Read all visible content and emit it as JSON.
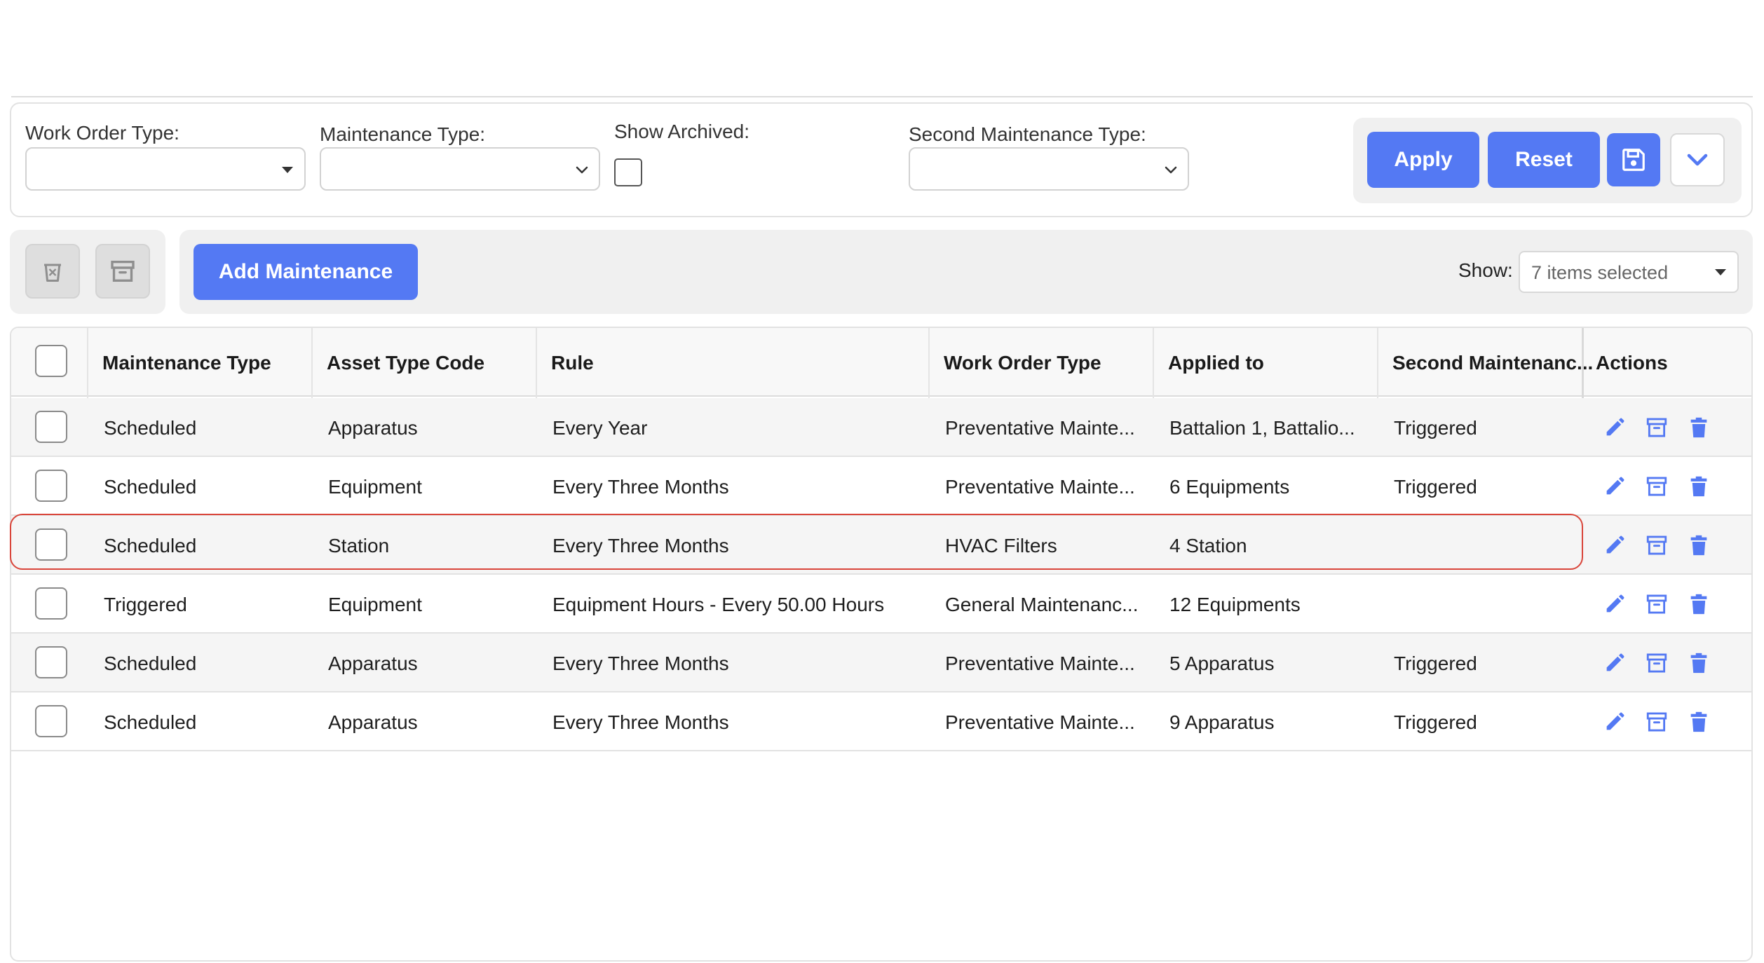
{
  "filters": {
    "work_order_type_label": "Work Order Type:",
    "work_order_type_value": "",
    "maintenance_type_label": "Maintenance Type:",
    "maintenance_type_value": "",
    "show_archived_label": "Show Archived:",
    "show_archived_checked": false,
    "second_maintenance_type_label": "Second Maintenance Type:",
    "second_maintenance_type_value": "",
    "apply_label": "Apply",
    "reset_label": "Reset"
  },
  "toolbar": {
    "add_label": "Add Maintenance",
    "show_label": "Show:",
    "show_value": "7 items selected"
  },
  "table": {
    "headers": [
      "Maintenance Type",
      "Asset Type Code",
      "Rule",
      "Work Order Type",
      "Applied to",
      "Second Maintenanc...",
      "Actions"
    ],
    "rows": [
      {
        "maintenance_type": "Scheduled",
        "asset_type_code": "Apparatus",
        "rule": "Every Year",
        "work_order_type": "Preventative Mainte...",
        "applied_to": "Battalion 1, Battalio...",
        "second": "Triggered"
      },
      {
        "maintenance_type": "Scheduled",
        "asset_type_code": "Equipment",
        "rule": "Every Three Months",
        "work_order_type": "Preventative Mainte...",
        "applied_to": "6 Equipments",
        "second": "Triggered"
      },
      {
        "maintenance_type": "Scheduled",
        "asset_type_code": "Station",
        "rule": "Every Three Months",
        "work_order_type": "HVAC Filters",
        "applied_to": "4 Station",
        "second": ""
      },
      {
        "maintenance_type": "Triggered",
        "asset_type_code": "Equipment",
        "rule": "Equipment Hours - Every 50.00 Hours",
        "work_order_type": "General Maintenanc...",
        "applied_to": "12 Equipments",
        "second": ""
      },
      {
        "maintenance_type": "Scheduled",
        "asset_type_code": "Apparatus",
        "rule": "Every Three Months",
        "work_order_type": "Preventative Mainte...",
        "applied_to": "5 Apparatus",
        "second": "Triggered"
      },
      {
        "maintenance_type": "Scheduled",
        "asset_type_code": "Apparatus",
        "rule": "Every Three Months",
        "work_order_type": "Preventative Mainte...",
        "applied_to": "9 Apparatus",
        "second": "Triggered"
      }
    ],
    "row_actions": [
      "edit-icon",
      "archive-icon",
      "trash-icon"
    ]
  },
  "colors": {
    "primary": "#5479f3",
    "highlight": "#d9453a"
  }
}
